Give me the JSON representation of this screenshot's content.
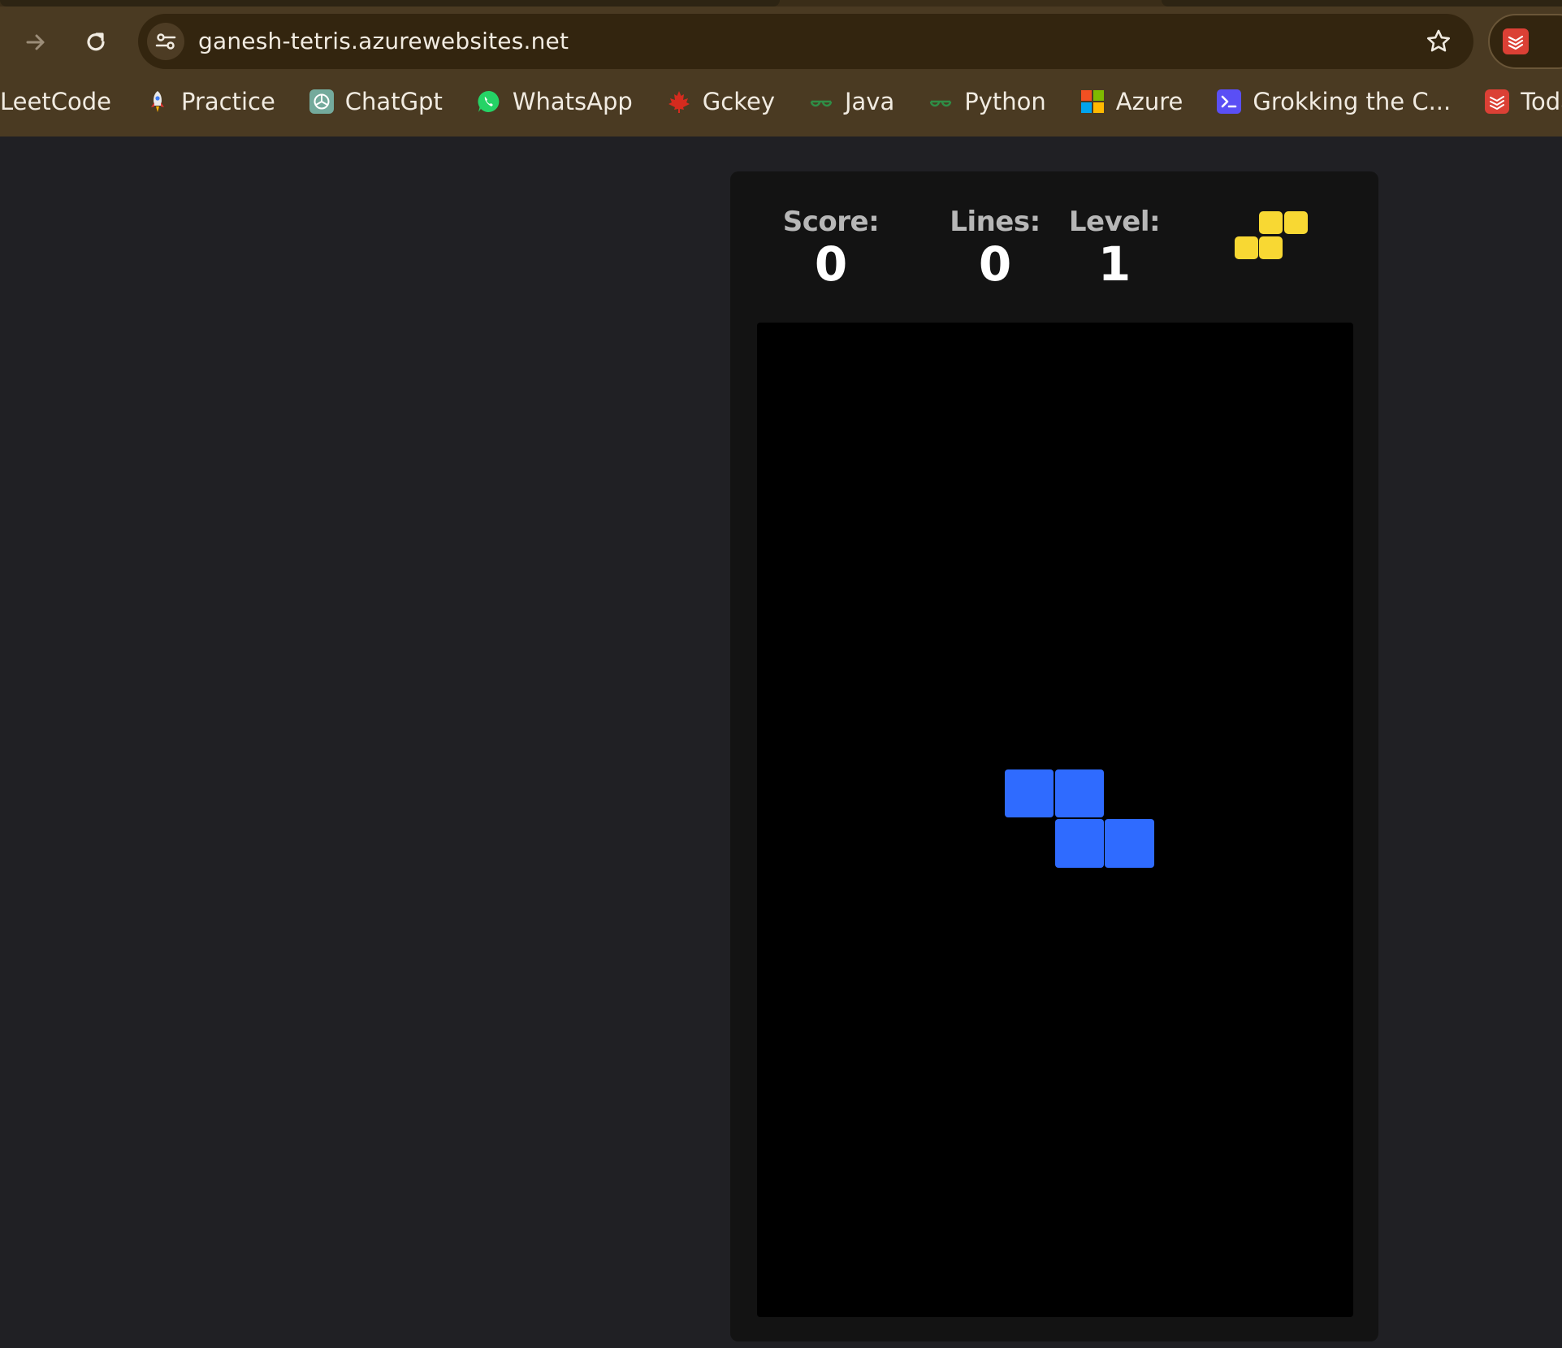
{
  "browser": {
    "url": "ganesh-tetris.azurewebsites.net",
    "bookmarks": [
      {
        "label": "LeetCode",
        "icon": "leetcode-icon"
      },
      {
        "label": "Practice",
        "icon": "rocket-icon"
      },
      {
        "label": "ChatGpt",
        "icon": "chatgpt-icon"
      },
      {
        "label": "WhatsApp",
        "icon": "whatsapp-icon"
      },
      {
        "label": "Gckey",
        "icon": "maple-leaf-icon"
      },
      {
        "label": "Java",
        "icon": "geeksforgeeks-icon"
      },
      {
        "label": "Python",
        "icon": "geeksforgeeks-icon"
      },
      {
        "label": "Azure",
        "icon": "microsoft-icon"
      },
      {
        "label": "Grokking the C...",
        "icon": "terminal-icon"
      },
      {
        "label": "Today – T",
        "icon": "todoist-icon"
      }
    ],
    "colors": {
      "chrome": "#4a3a22",
      "omnibox": "#33250f",
      "text": "#f1ebe1"
    }
  },
  "game": {
    "score_label": "Score:",
    "score": "0",
    "lines_label": "Lines:",
    "lines": "0",
    "level_label": "Level:",
    "level": "1",
    "next_piece": {
      "type": "S",
      "color": "#f8d833"
    },
    "active_piece": {
      "type": "Z",
      "color": "#2f6bff"
    },
    "colors": {
      "page_bg": "#202024",
      "panel_bg": "#131313",
      "board_bg": "#000000"
    }
  }
}
